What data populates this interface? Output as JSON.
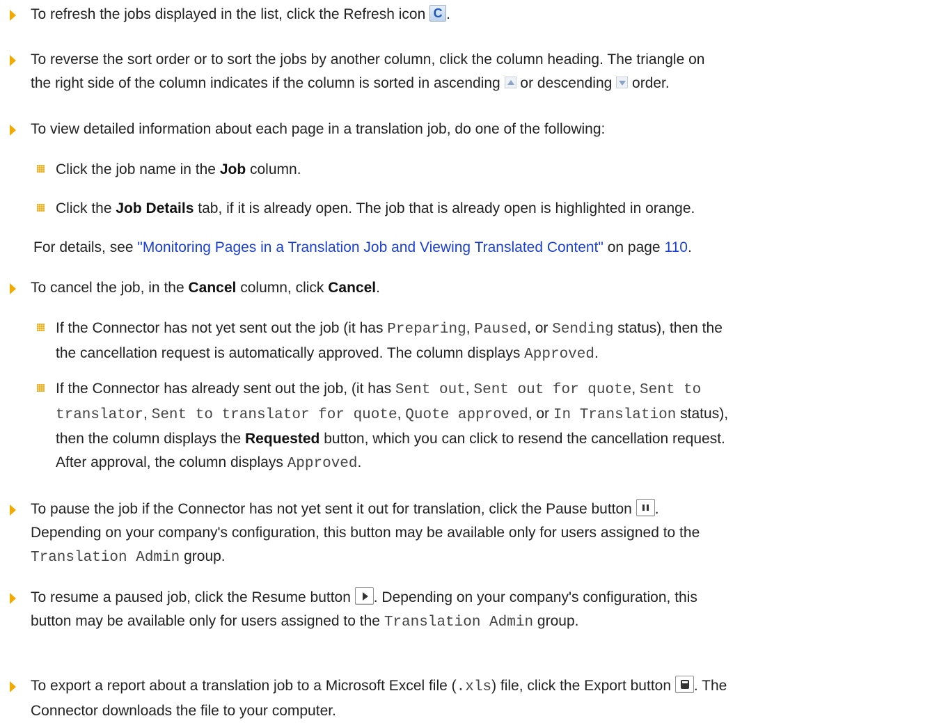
{
  "refresh": {
    "text": "To refresh the jobs displayed in the list, click the Refresh icon",
    "end": "."
  },
  "sort": {
    "line1": "To reverse the sort order or to sort the jobs by another column, click the column heading. The triangle on",
    "line2a": "the right side of the column indicates if the column is sorted in ascending",
    "line2b": "or descending",
    "line2c": "order."
  },
  "view": {
    "text": "To view detailed information about each page in a translation job, do one of the following:",
    "sub1": {
      "pre": "Click the job name in the",
      "bold": "Job",
      "post": "column."
    },
    "sub2": {
      "pre": "Click the",
      "bold": "Job Details",
      "post": "tab, if it is already open. The job that is already open is highlighted in orange."
    },
    "details_pre": "For details, see",
    "details_link": "\"Monitoring Pages in a Translation Job and Viewing Translated Content\"",
    "details_mid": "on page",
    "details_page": "110",
    "details_end": "."
  },
  "cancel": {
    "pre": "To cancel the job, in the",
    "bold1": "Cancel",
    "mid": "column, click",
    "bold2": "Cancel",
    "end": ".",
    "sub1": {
      "t1": "If the Connector has not yet sent out the job (it has",
      "c1": "Preparing",
      "t2": ",",
      "c2": "Paused",
      "t3": ", or",
      "c3": "Sending",
      "t4": "status), then the",
      "t5": "the cancellation request is automatically approved. The column displays",
      "c4": "Approved",
      "t6": "."
    },
    "sub2": {
      "t1": "If the Connector has already sent out the job, (it has",
      "c1": "Sent out",
      "t2": ",",
      "c2": "Sent out for quote",
      "t3": ",",
      "c3": "Sent to",
      "c4": "translator",
      "t4": ",",
      "c5": "Sent to translator for quote",
      "t5": ",",
      "c6": "Quote approved",
      "t6": ", or",
      "c7": "In Translation",
      "t7": "status),",
      "t8": "then the column displays the",
      "bold": "Requested",
      "t9": "button, which you can click to resend the cancellation request.",
      "t10": "After approval, the column displays",
      "c8": "Approved",
      "t11": "."
    }
  },
  "pause": {
    "t1": "To pause the job if the Connector has not yet sent it out for translation, click the Pause button",
    "t2": ".",
    "t3": "Depending on your company's configuration, this button may be available only for users assigned to the",
    "code": "Translation Admin",
    "t4": "group."
  },
  "resume": {
    "t1": "To resume a paused job, click the Resume button",
    "t2": ". Depending on your company's configuration, this",
    "t3": "button may be available only for users assigned to the",
    "code": "Translation Admin",
    "t4": "group."
  },
  "export": {
    "t1": "To export a report about a translation job to a Microsoft Excel file (",
    "code": ".xls",
    "t2": ") file, click the Export button",
    "t3": ". The",
    "t4": "Connector downloads the file to your computer."
  }
}
